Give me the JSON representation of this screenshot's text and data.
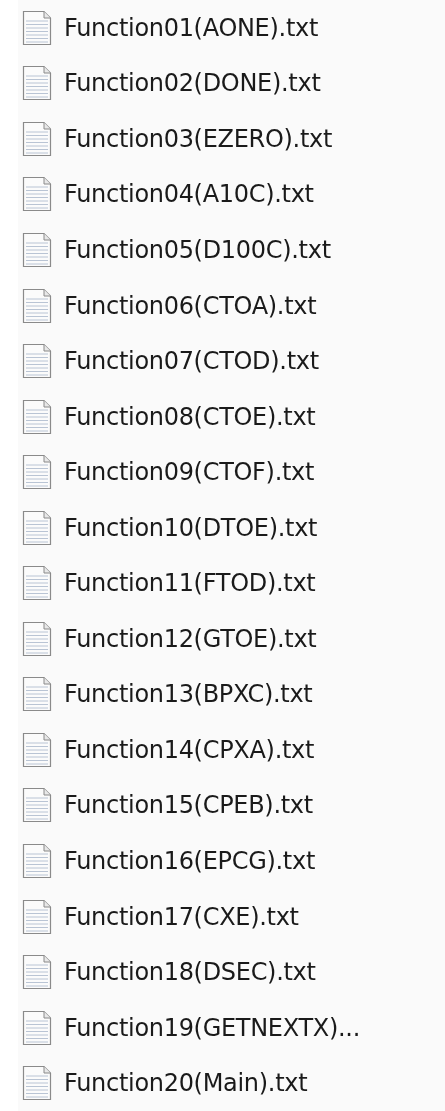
{
  "files": [
    {
      "name": "Function01(AONE).txt"
    },
    {
      "name": "Function02(DONE).txt"
    },
    {
      "name": "Function03(EZERO).txt"
    },
    {
      "name": "Function04(A10C).txt"
    },
    {
      "name": "Function05(D100C).txt"
    },
    {
      "name": "Function06(CTOA).txt"
    },
    {
      "name": "Function07(CTOD).txt"
    },
    {
      "name": "Function08(CTOE).txt"
    },
    {
      "name": "Function09(CTOF).txt"
    },
    {
      "name": "Function10(DTOE).txt"
    },
    {
      "name": "Function11(FTOD).txt"
    },
    {
      "name": "Function12(GTOE).txt"
    },
    {
      "name": "Function13(BPXC).txt"
    },
    {
      "name": "Function14(CPXA).txt"
    },
    {
      "name": "Function15(CPEB).txt"
    },
    {
      "name": "Function16(EPCG).txt"
    },
    {
      "name": "Function17(CXE).txt"
    },
    {
      "name": "Function18(DSEC).txt"
    },
    {
      "name": "Function19(GETNEXTX)..."
    },
    {
      "name": "Function20(Main).txt"
    }
  ]
}
